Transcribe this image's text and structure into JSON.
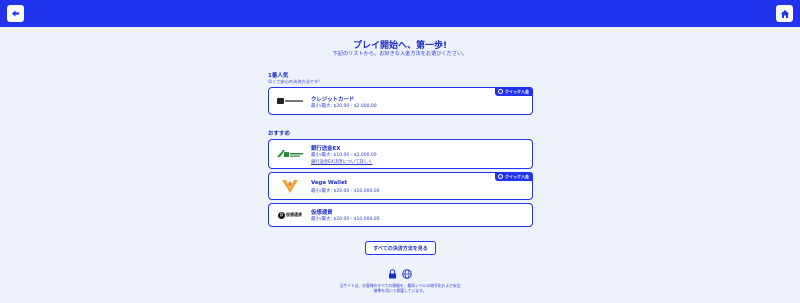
{
  "header": {
    "back_icon": "back-arrow-icon",
    "home_icon": "home-icon",
    "bar_color": "#2233ee"
  },
  "main": {
    "title": "プレイ開始へ、第一歩!",
    "subtitle": "下記のリストから、お好きな入金方法をお選びください。"
  },
  "popular": {
    "label": "1番人気",
    "sub": "早くて安心の決済方法です!",
    "items": [
      {
        "name": "クレジットカード",
        "limit": "最小/最大: $20.00 - $2,000.00",
        "badge": "クイック入金",
        "logo": "credit-card-logo"
      }
    ]
  },
  "recommended": {
    "label": "おすすめ",
    "items": [
      {
        "name": "銀行送金EX",
        "limit": "最小/最大: $10.00 - $2,000.00",
        "link": "銀行送金EX決済について詳しく",
        "logo": "bank-transfer-logo"
      },
      {
        "name": "Vega Wallet",
        "limit": "最小/最大: $20.00 - $10,000.00",
        "badge": "クイック入金",
        "logo": "vega-wallet-logo"
      },
      {
        "name": "仮想通貨",
        "limit": "最小/最大: $20.00 - $10,000.00",
        "logo": "crypto-logo",
        "logo_text": "仮想通貨"
      }
    ]
  },
  "all_methods_button": "すべての決済方法を見る",
  "footer": {
    "icons": [
      "lock-icon",
      "security-globe-icon"
    ],
    "line1": "当サイトは、お客様のすべての情報を、最高レベルの暗号化および安全",
    "line2": "基準を用いて保護しています。"
  }
}
